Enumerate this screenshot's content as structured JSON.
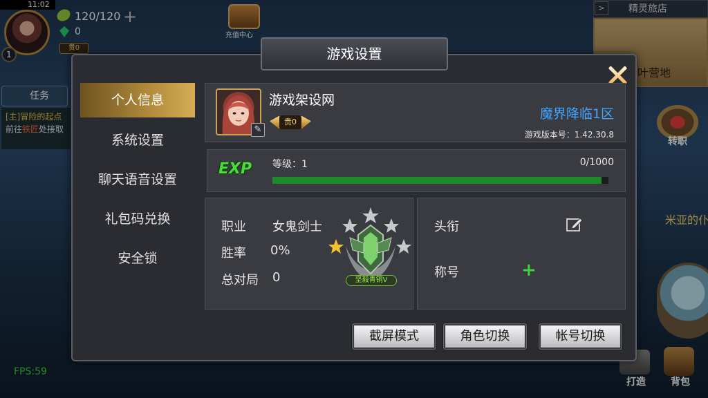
{
  "hud": {
    "clock": "11:02",
    "stamina": "120/120",
    "gems": "0",
    "vip": "贵0",
    "recharge_label": "充值中心",
    "task_button": "任务",
    "task_line1": "[主]冒险的起点",
    "task_line2_prefix": "前往",
    "task_line2_highlight": "铁匠",
    "task_line2_suffix": "处接取",
    "inn_title": "精灵旅店",
    "inn_map_label": "叶营地",
    "transfer_label": "转职",
    "right_text": "米亚的仆",
    "fps": "FPS:59",
    "forge_label": "打造",
    "bag_label": "背包"
  },
  "dialog": {
    "title": "游戏设置",
    "nav": [
      {
        "label": "个人信息",
        "active": true
      },
      {
        "label": "系统设置",
        "active": false
      },
      {
        "label": "聊天语音设置",
        "active": false
      },
      {
        "label": "礼包码兑换",
        "active": false
      },
      {
        "label": "安全锁",
        "active": false
      }
    ],
    "profile": {
      "name": "游戏架设网",
      "rank_badge": "贵0",
      "server": "魔界降临1区",
      "version": "游戏版本号：1.42.30.8"
    },
    "exp": {
      "logo": "EXP",
      "level_label": "等级：1",
      "progress_text": "0/1000",
      "progress_fraction": 0.98
    },
    "stats": {
      "job_label": "职业",
      "job_value": "女鬼剑士",
      "winrate_label": "胜率",
      "winrate_value": "0%",
      "games_label": "总对局",
      "games_value": "0",
      "rank_name": "坚毅青铜V"
    },
    "titles": {
      "headwear_label": "头衔",
      "title_label": "称号"
    },
    "buttons": {
      "screenshot": "截屏模式",
      "switch_role": "角色切换",
      "switch_account": "帐号切换"
    }
  },
  "colors": {
    "accent_gold": "#b18b3b",
    "server_blue": "#40a6ff",
    "exp_green": "#1c8a2a",
    "plus_green": "#3fd03f",
    "fps_green": "#3bd13b"
  }
}
